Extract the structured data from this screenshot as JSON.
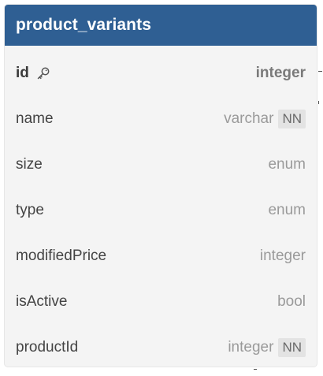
{
  "table": {
    "name": "product_variants",
    "columns": [
      {
        "name": "id",
        "type": "integer",
        "primary_key": true,
        "icon": "key-icon",
        "badge": ""
      },
      {
        "name": "name",
        "type": "varchar",
        "badge": "NN"
      },
      {
        "name": "size",
        "type": "enum",
        "badge": ""
      },
      {
        "name": "type",
        "type": "enum",
        "badge": ""
      },
      {
        "name": "modifiedPrice",
        "type": "integer",
        "badge": ""
      },
      {
        "name": "isActive",
        "type": "bool",
        "badge": ""
      },
      {
        "name": "productId",
        "type": "integer",
        "badge": "NN"
      }
    ]
  },
  "colors": {
    "header_bg": "#2f5f93",
    "card_bg": "#f4f4f4",
    "badge_bg": "#e3e3e3"
  }
}
